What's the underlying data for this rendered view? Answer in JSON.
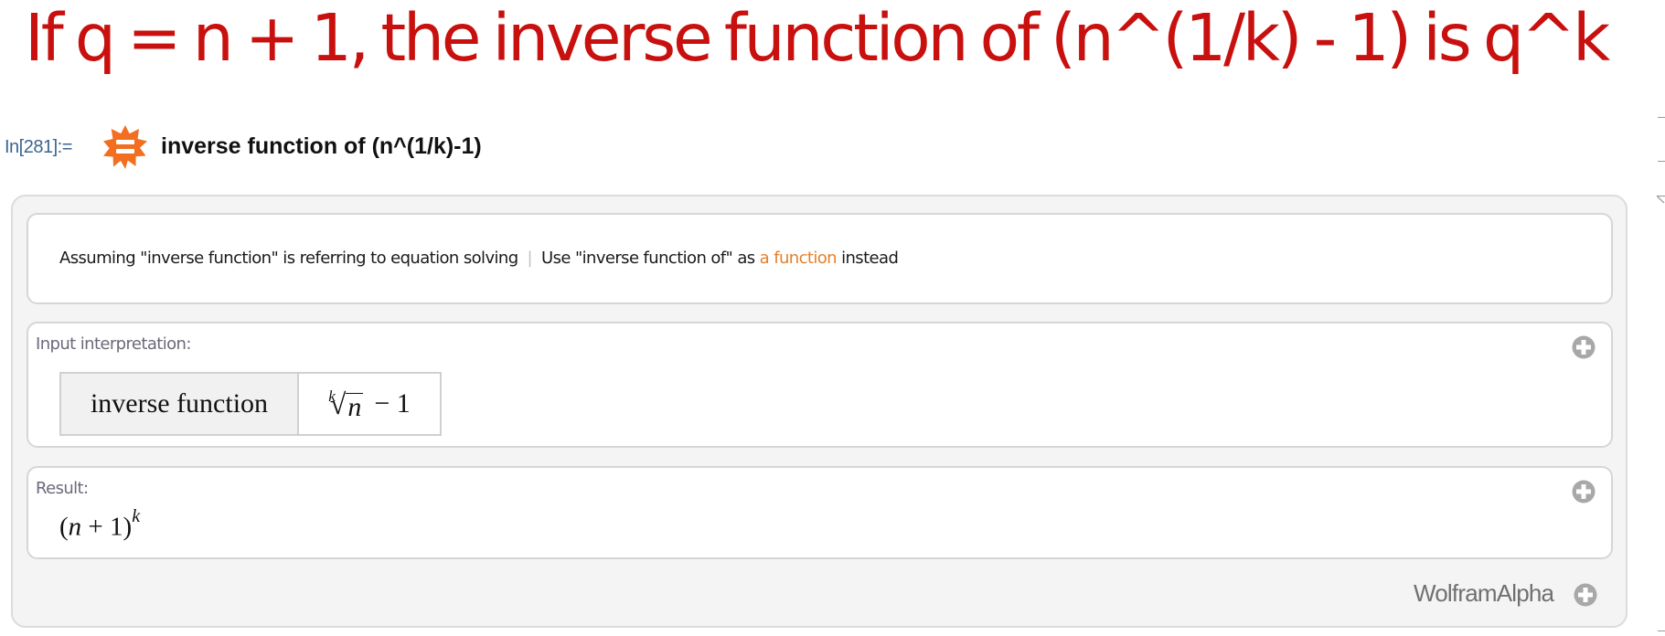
{
  "headline": "If q = n + 1, the inverse function of (n^(1/k) - 1) is q^k",
  "cell": {
    "in_label": "In[281]:=",
    "query_icon": "wolfram-alpha-spikey-icon",
    "query": "inverse function of (n^(1/k)-1)"
  },
  "assumption": {
    "prefix": "Assuming \"inverse function\" is referring to equation solving",
    "separator": "|",
    "alt_prefix": "Use \"inverse function of\" as ",
    "alt_link": "a function",
    "alt_suffix": " instead"
  },
  "pods": {
    "input_interpretation": {
      "title": "Input interpretation:",
      "label": "inverse function",
      "value_index": "k",
      "value_radical": "√",
      "value_radicand": "n",
      "value_tail": "− 1",
      "expand_icon": "plus-circle-icon"
    },
    "result": {
      "title": "Result:",
      "expr_open": "(",
      "expr_var": "n",
      "expr_mid": " + 1)",
      "expr_exponent": "k",
      "expand_icon": "plus-circle-icon"
    }
  },
  "footer": {
    "brand": "WolframAlpha",
    "expand_icon": "plus-circle-icon"
  },
  "colors": {
    "headline": "#c8100e",
    "in_label": "#3d6490",
    "spikey": "#f26f21",
    "link": "#e5802b",
    "plus": "#a8a8a8"
  }
}
